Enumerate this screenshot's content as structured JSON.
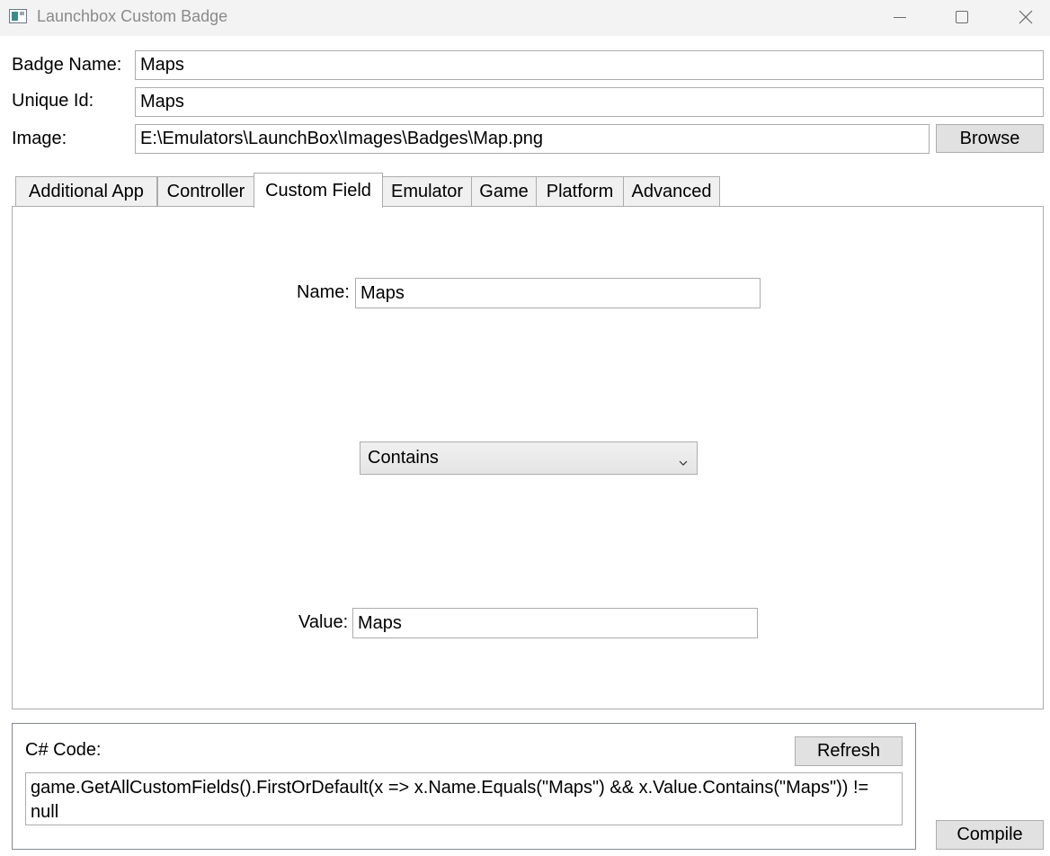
{
  "window": {
    "title": "Launchbox Custom Badge",
    "icon": "app-window-icon",
    "controls": [
      "minimize-icon",
      "maximize-icon",
      "close-icon"
    ]
  },
  "form": {
    "badge_name_label": "Badge Name:",
    "badge_name_value": "Maps",
    "unique_id_label": "Unique Id:",
    "unique_id_value": "Maps",
    "image_label": "Image:",
    "image_value": "E:\\Emulators\\LaunchBox\\Images\\Badges\\Map.png",
    "browse_label": "Browse"
  },
  "tabs": [
    {
      "label": "Additional App",
      "active": false
    },
    {
      "label": "Controller",
      "active": false
    },
    {
      "label": "Custom Field",
      "active": true
    },
    {
      "label": "Emulator",
      "active": false
    },
    {
      "label": "Game",
      "active": false
    },
    {
      "label": "Platform",
      "active": false
    },
    {
      "label": "Advanced",
      "active": false
    }
  ],
  "custom_field": {
    "name_label": "Name:",
    "name_value": "Maps",
    "operator_value": "Contains",
    "value_label": "Value:",
    "value_value": "Maps"
  },
  "code": {
    "label": "C# Code:",
    "refresh_label": "Refresh",
    "content": "game.GetAllCustomFields().FirstOrDefault(x => x.Name.Equals(\"Maps\") && x.Value.Contains(\"Maps\")) != null"
  },
  "compile_label": "Compile"
}
